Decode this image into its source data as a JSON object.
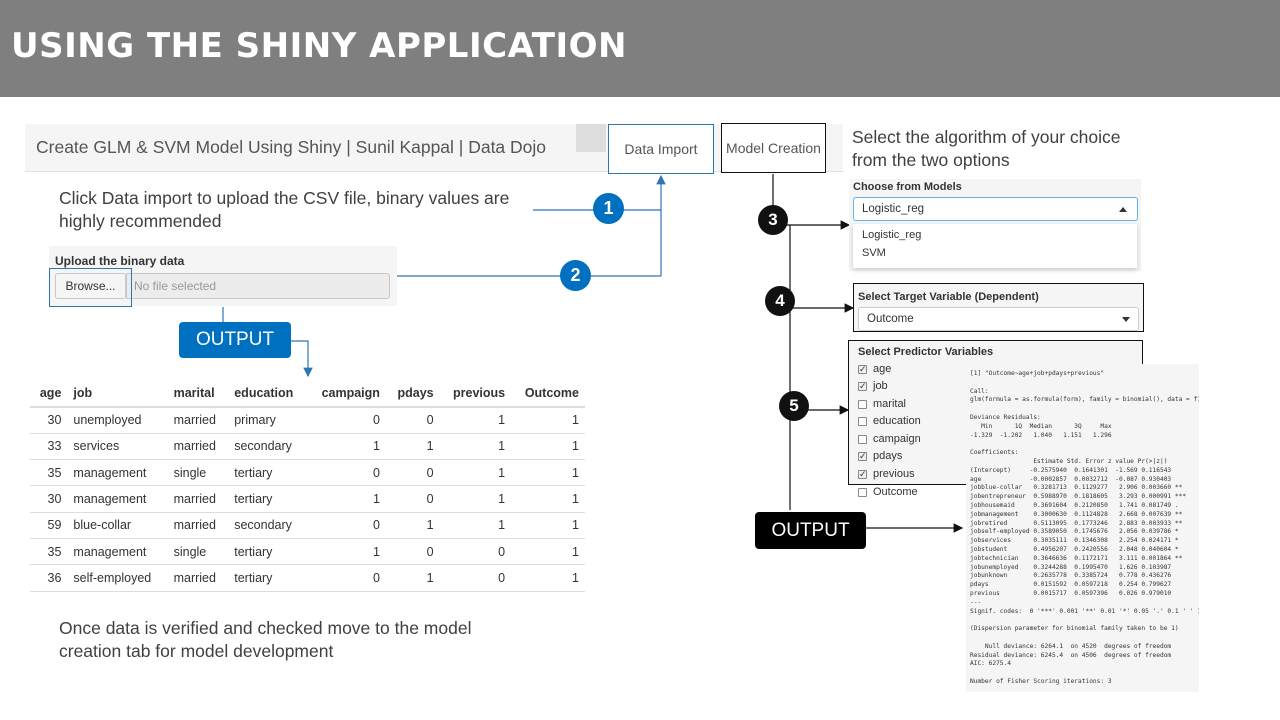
{
  "slide": {
    "title": "USING THE SHINY APPLICATION"
  },
  "app": {
    "title": "Create GLM & SVM Model Using Shiny | Sunil Kappal | Data Dojo",
    "tabs": [
      {
        "label": "Data Import"
      },
      {
        "label": "Model Creation"
      }
    ]
  },
  "notes": {
    "click_import": "Click Data import to upload the CSV file, binary values are highly recommended",
    "once_verified": "Once data is verified and checked move to the model creation tab for model development",
    "select_algorithm": "Select the algorithm of your choice from the two options"
  },
  "upload": {
    "label": "Upload the binary data",
    "browse_label": "Browse...",
    "file_placeholder": "No file selected"
  },
  "badges": {
    "one": "1",
    "two": "2",
    "three": "3",
    "four": "4",
    "five": "5"
  },
  "output_labels": {
    "left": "OUTPUT",
    "right": "OUTPUT"
  },
  "table": {
    "headers": [
      "age",
      "job",
      "marital",
      "education",
      "campaign",
      "pdays",
      "previous",
      "Outcome"
    ],
    "rows": [
      [
        "30",
        "unemployed",
        "married",
        "primary",
        "0",
        "0",
        "1",
        "1"
      ],
      [
        "33",
        "services",
        "married",
        "secondary",
        "1",
        "1",
        "1",
        "1"
      ],
      [
        "35",
        "management",
        "single",
        "tertiary",
        "0",
        "0",
        "1",
        "1"
      ],
      [
        "30",
        "management",
        "married",
        "tertiary",
        "1",
        "0",
        "1",
        "1"
      ],
      [
        "59",
        "blue-collar",
        "married",
        "secondary",
        "0",
        "1",
        "1",
        "1"
      ],
      [
        "35",
        "management",
        "single",
        "tertiary",
        "1",
        "0",
        "0",
        "1"
      ],
      [
        "36",
        "self-employed",
        "married",
        "tertiary",
        "0",
        "1",
        "0",
        "1"
      ]
    ]
  },
  "models": {
    "label": "Choose from Models",
    "selected": "Logistic_reg",
    "options": [
      "Logistic_reg",
      "SVM"
    ],
    "partial_option": "age"
  },
  "target": {
    "label": "Select Target Variable (Dependent)",
    "selected": "Outcome"
  },
  "predictors": {
    "label": "Select Predictor Variables",
    "items": [
      {
        "name": "age",
        "checked": true
      },
      {
        "name": "job",
        "checked": true
      },
      {
        "name": "marital",
        "checked": false
      },
      {
        "name": "education",
        "checked": false
      },
      {
        "name": "campaign",
        "checked": false
      },
      {
        "name": "pdays",
        "checked": true
      },
      {
        "name": "previous",
        "checked": true
      },
      {
        "name": "Outcome",
        "checked": false
      }
    ]
  },
  "r_output": {
    "lines": [
      "[1] \"Outcome~age+job+pdays+previous\"",
      "",
      "Call:",
      "glm(formula = as.formula(form), family = binomial(), data = f)",
      "",
      "Deviance Residuals:",
      "   Min      1Q  Median      3Q     Max",
      "-1.329  -1.202   1.040   1.151   1.296",
      "",
      "Coefficients:",
      "                 Estimate Std. Error z value Pr(>|z|)",
      "(Intercept)     -0.2575940  0.1641301  -1.569 0.116543",
      "age             -0.0002857  0.0032712  -0.087 0.930403",
      "jobblue-collar   0.3281713  0.1129277   2.906 0.003660 **",
      "jobentrepreneur  0.5988970  0.1818605   3.293 0.000991 ***",
      "jobhousemaid     0.3691604  0.2120850   1.741 0.081749 .",
      "jobmanagement    0.3000630  0.1124828   2.668 0.007639 **",
      "jobretired       0.5113095  0.1773246   2.883 0.003933 **",
      "jobself-employed 0.3589050  0.1745676   2.056 0.039786 *",
      "jobservices      0.3035111  0.1346308   2.254 0.024171 *",
      "jobstudent       0.4956207  0.2420556   2.048 0.040604 *",
      "jobtechnician    0.3646636  0.1172171   3.111 0.001864 **",
      "jobunemployed    0.3244288  0.1995470   1.626 0.103987",
      "jobunknown       0.2635778  0.3385724   0.778 0.436276",
      "pdays            0.0151592  0.0597218   0.254 0.799627",
      "previous         0.0015717  0.0597396   0.026 0.979010",
      "---",
      "Signif. codes:  0 '***' 0.001 '**' 0.01 '*' 0.05 '.' 0.1 ' ' 1",
      "",
      "(Dispersion parameter for binomial family taken to be 1)",
      "",
      "    Null deviance: 6264.1  on 4520  degrees of freedom",
      "Residual deviance: 6245.4  on 4506  degrees of freedom",
      "AIC: 6275.4",
      "",
      "Number of Fisher Scoring iterations: 3"
    ]
  },
  "colors": {
    "header_bg": "#7f7f7f",
    "accent_blue": "#0070c0",
    "badge_black": "#111111"
  }
}
